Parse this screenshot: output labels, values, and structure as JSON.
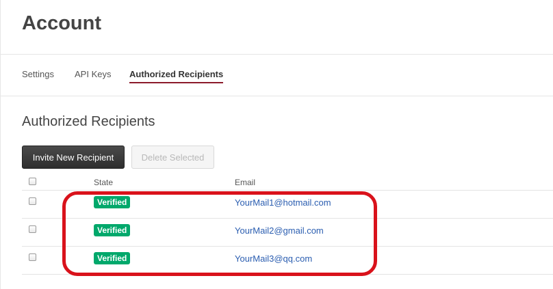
{
  "page": {
    "title": "Account"
  },
  "tabs": [
    {
      "label": "Settings",
      "active": false
    },
    {
      "label": "API Keys",
      "active": false
    },
    {
      "label": "Authorized Recipients",
      "active": true
    }
  ],
  "section": {
    "title": "Authorized Recipients",
    "invite_button": "Invite New Recipient",
    "delete_button": "Delete Selected"
  },
  "table": {
    "headers": {
      "state": "State",
      "email": "Email"
    },
    "rows": [
      {
        "state": "Verified",
        "email": "YourMail1@hotmail.com"
      },
      {
        "state": "Verified",
        "email": "YourMail2@gmail.com"
      },
      {
        "state": "Verified",
        "email": "YourMail3@qq.com"
      }
    ]
  },
  "colors": {
    "accent_underline": "#8b1a2b",
    "verified_badge": "#00a86b",
    "link": "#2a5db0",
    "highlight": "#d9121b"
  }
}
